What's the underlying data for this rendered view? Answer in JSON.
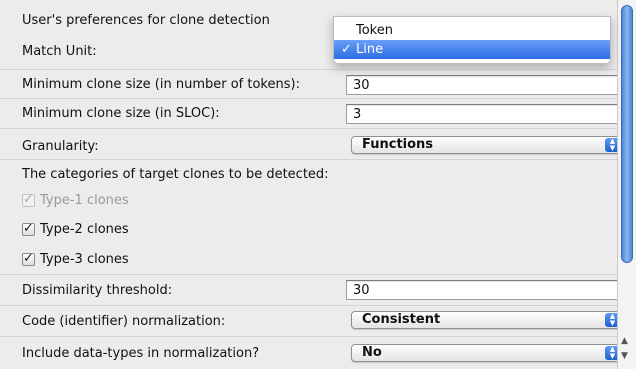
{
  "form": {
    "header": "User's preferences for clone detection",
    "match_unit": {
      "label": "Match Unit:",
      "value": "Line"
    },
    "min_tokens": {
      "label": "Minimum clone size (in number of tokens):",
      "value": "30"
    },
    "min_sloc": {
      "label": "Minimum clone size (in SLOC):",
      "value": "3"
    },
    "granularity": {
      "label": "Granularity:",
      "value": "Functions"
    },
    "categories_label": "The categories of target clones to be detected:",
    "clone_types": [
      {
        "label": "Type-1 clones",
        "checked": true,
        "enabled": false
      },
      {
        "label": "Type-2 clones",
        "checked": true,
        "enabled": true
      },
      {
        "label": "Type-3 clones",
        "checked": true,
        "enabled": true
      }
    ],
    "dissimilarity": {
      "label": "Dissimilarity threshold:",
      "value": "30"
    },
    "normalization": {
      "label": "Code (identifier) normalization:",
      "value": "Consistent"
    },
    "datatypes": {
      "label": "Include data-types in normalization?",
      "value": "No"
    }
  },
  "dropdown_menu": {
    "items": [
      {
        "label": "Token",
        "selected": false
      },
      {
        "label": "Line",
        "selected": true
      }
    ],
    "check_glyph": "✓"
  },
  "icons": {
    "checkmark": "check-icon",
    "popup_arrows": "updown-arrows-icon",
    "scroll_up": "scroll-up-arrow-icon",
    "scroll_down": "scroll-down-arrow-icon"
  },
  "colors": {
    "menu_highlight": "#2c6ce6",
    "scroll_thumb": "#4f86d6"
  }
}
